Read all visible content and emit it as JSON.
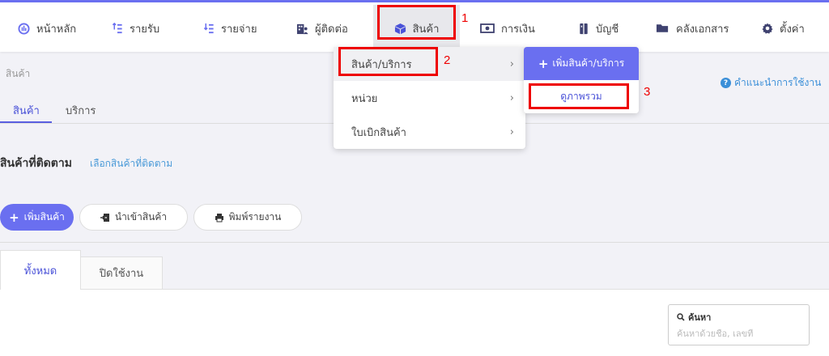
{
  "nav": {
    "items": [
      {
        "label": "หน้าหลัก",
        "icon": "dashboard-icon"
      },
      {
        "label": "รายรับ",
        "icon": "income-list-icon"
      },
      {
        "label": "รายจ่าย",
        "icon": "expense-list-icon"
      },
      {
        "label": "ผู้ติดต่อ",
        "icon": "contact-icon"
      },
      {
        "label": "สินค้า",
        "icon": "box-icon"
      },
      {
        "label": "การเงิน",
        "icon": "money-icon"
      },
      {
        "label": "บัญชี",
        "icon": "ledger-icon"
      },
      {
        "label": "คลังเอกสาร",
        "icon": "folder-icon"
      },
      {
        "label": "ตั้งค่า",
        "icon": "gear-icon"
      }
    ],
    "active": "สินค้า"
  },
  "annotations": {
    "m1": "1",
    "m2": "2",
    "m3": "3",
    "color": "#e00000"
  },
  "dropdown": {
    "items": [
      {
        "label": "สินค้า/บริการ"
      },
      {
        "label": "หน่วย"
      },
      {
        "label": "ใบเบิกสินค้า"
      }
    ],
    "chevron": "›"
  },
  "submenu": {
    "add_label": "เพิ่มสินค้า/บริการ",
    "overview_label": "ดูภาพรวม"
  },
  "page": {
    "breadcrumb": "สินค้า",
    "help_label": "คำแนะนำการใช้งาน",
    "subtabs": [
      "สินค้า",
      "บริการ"
    ],
    "follow_title": "สินค้าที่ติดตาม",
    "follow_link": "เลือกสินค้าที่ติดตาม",
    "buttons": {
      "add": "เพิ่มสินค้า",
      "import": "นำเข้าสินค้า",
      "print": "พิมพ์รายงาน"
    },
    "tabs": [
      "ทั้งหมด",
      "ปิดใช้งาน"
    ],
    "search_label": "ค้นหา",
    "search_placeholder": "ค้นหาด้วยชื่อ, เลขที่"
  },
  "colors": {
    "accent": "#6a6ff0",
    "link": "#3b8fd8",
    "annotation": "#e00000"
  }
}
